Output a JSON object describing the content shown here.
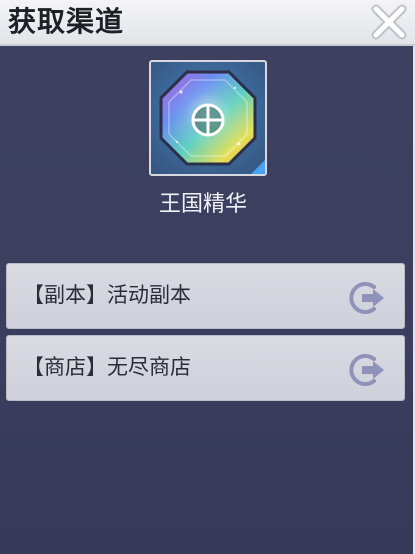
{
  "window": {
    "title": "获取渠道",
    "close_icon": "close-icon"
  },
  "item": {
    "name": "王国精华",
    "icon": "prism-gem-icon"
  },
  "sources": [
    {
      "label": "【副本】活动副本",
      "icon": "goto-arrow-icon"
    },
    {
      "label": "【商店】无尽商店",
      "icon": "goto-arrow-icon"
    }
  ],
  "colors": {
    "panel_bg": "#3c3f5c",
    "header_bg": "#e9eaee",
    "row_bg": "#d4d5de",
    "icon_tint": "#8f93b8"
  }
}
